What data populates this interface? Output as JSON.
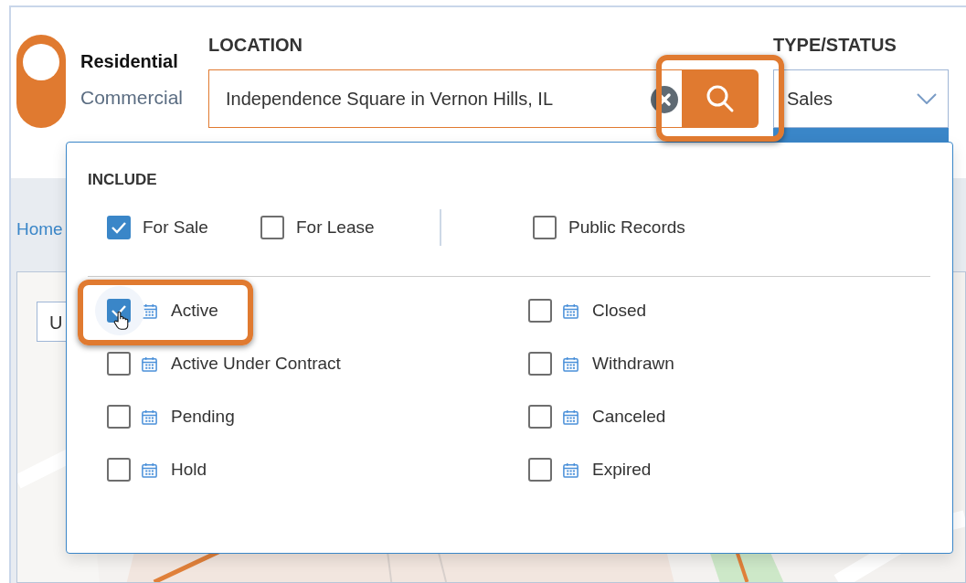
{
  "property_toggle": {
    "options": [
      {
        "label": "Residential",
        "selected": true
      },
      {
        "label": "Commercial",
        "selected": false
      }
    ]
  },
  "location": {
    "label": "LOCATION",
    "value": "Independence Square in Vernon Hills, IL",
    "search_highlighted": true
  },
  "type_status": {
    "label": "TYPE/STATUS",
    "value": "Sales"
  },
  "breadcrumb": {
    "link": "Home"
  },
  "map": {
    "field_text": "U"
  },
  "include_panel": {
    "title": "INCLUDE",
    "types": [
      {
        "label": "For Sale",
        "checked": true
      },
      {
        "label": "For Lease",
        "checked": false
      }
    ],
    "extra_types": [
      {
        "label": "Public Records",
        "checked": false
      }
    ],
    "statuses_left": [
      {
        "label": "Active",
        "checked": true,
        "highlighted": true
      },
      {
        "label": "Active Under Contract",
        "checked": false,
        "highlighted": false
      },
      {
        "label": "Pending",
        "checked": false,
        "highlighted": false
      },
      {
        "label": "Hold",
        "checked": false,
        "highlighted": false
      }
    ],
    "statuses_right": [
      {
        "label": "Closed",
        "checked": false,
        "highlighted": false
      },
      {
        "label": "Withdrawn",
        "checked": false,
        "highlighted": false
      },
      {
        "label": "Canceled",
        "checked": false,
        "highlighted": false
      },
      {
        "label": "Expired",
        "checked": false,
        "highlighted": false
      }
    ]
  }
}
